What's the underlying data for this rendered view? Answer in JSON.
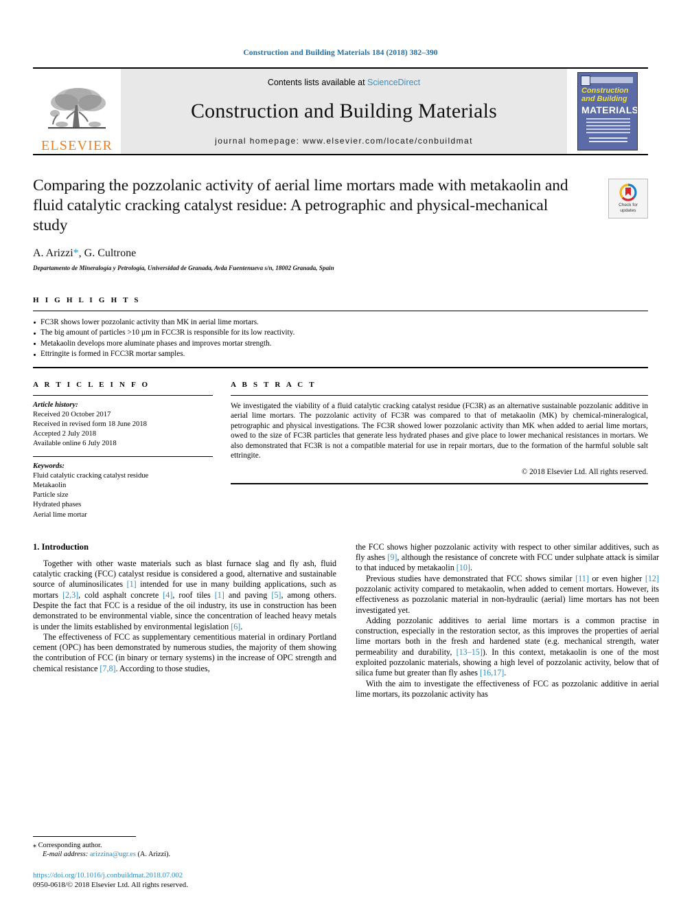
{
  "running_head": "Construction and Building Materials 184 (2018) 382–390",
  "masthead": {
    "publisher_name": "ELSEVIER",
    "contents_prefix": "Contents lists available at ",
    "contents_link": "ScienceDirect",
    "journal_title": "Construction and Building Materials",
    "homepage": "journal homepage: www.elsevier.com/locate/conbuildmat",
    "cover": {
      "line1": "Construction",
      "line2": "and Building",
      "line3": "MATERIALS"
    }
  },
  "article": {
    "title": "Comparing the pozzolanic activity of aerial lime mortars made with metakaolin and fluid catalytic cracking catalyst residue: A petrographic and physical-mechanical study",
    "authors_pre": "A. Arizzi",
    "authors_star": "*",
    "authors_post": ", G. Cultrone",
    "affiliation": "Departamento de Mineralogía y Petrología, Universidad de Granada, Avda Fuentenueva s/n, 18002 Granada, Spain",
    "crossmark_line1": "Check for",
    "crossmark_line2": "updates"
  },
  "highlights": {
    "heading": "H I G H L I G H T S",
    "items": [
      "FC3R shows lower pozzolanic activity than MK in aerial lime mortars.",
      "The big amount of particles >10 µm in FCC3R is responsible for its low reactivity.",
      "Metakaolin develops more aluminate phases and improves mortar strength.",
      "Ettringite is formed in FCC3R mortar samples."
    ]
  },
  "article_info": {
    "heading": "A R T I C L E   I N F O",
    "history_label": "Article history:",
    "history": [
      "Received 20 October 2017",
      "Received in revised form 18 June 2018",
      "Accepted 2 July 2018",
      "Available online 6 July 2018"
    ],
    "keywords_label": "Keywords:",
    "keywords": [
      "Fluid catalytic cracking catalyst residue",
      "Metakaolin",
      "Particle size",
      "Hydrated phases",
      "Aerial lime mortar"
    ]
  },
  "abstract": {
    "heading": "A B S T R A C T",
    "text": "We investigated the viability of a fluid catalytic cracking catalyst residue (FC3R) as an alternative sustainable pozzolanic additive in aerial lime mortars. The pozzolanic activity of FC3R was compared to that of metakaolin (MK) by chemical-mineralogical, petrographic and physical investigations. The FC3R showed lower pozzolanic activity than MK when added to aerial lime mortars, owed to the size of FC3R particles that generate less hydrated phases and give place to lower mechanical resistances in mortars. We also demonstrated that FC3R is not a compatible material for use in repair mortars, due to the formation of the harmful soluble salt ettringite.",
    "copyright": "© 2018 Elsevier Ltd. All rights reserved."
  },
  "body": {
    "section_heading": "1. Introduction",
    "left_paragraphs": [
      {
        "parts": [
          {
            "t": "Together with other waste materials such as blast furnace slag and fly ash, fluid catalytic cracking (FCC) catalyst residue is considered a good, alternative and sustainable source of aluminosilicates "
          },
          {
            "t": "[1]",
            "ref": true
          },
          {
            "t": " intended for use in many building applications, such as mortars "
          },
          {
            "t": "[2,3]",
            "ref": true
          },
          {
            "t": ", cold asphalt concrete "
          },
          {
            "t": "[4]",
            "ref": true
          },
          {
            "t": ", roof tiles "
          },
          {
            "t": "[1]",
            "ref": true
          },
          {
            "t": " and paving "
          },
          {
            "t": "[5]",
            "ref": true
          },
          {
            "t": ", among others. Despite the fact that FCC is a residue of the oil industry, its use in construction has been demonstrated to be environmental viable, since the concentration of leached heavy metals is under the limits established by environmental legislation "
          },
          {
            "t": "[6]",
            "ref": true
          },
          {
            "t": "."
          }
        ]
      },
      {
        "parts": [
          {
            "t": "The effectiveness of FCC as supplementary cementitious material in ordinary Portland cement (OPC) has been demonstrated by numerous studies, the majority of them showing the contribution of FCC (in binary or ternary systems) in the increase of OPC strength and chemical resistance "
          },
          {
            "t": "[7,8]",
            "ref": true
          },
          {
            "t": ". According to those studies,"
          }
        ]
      }
    ],
    "right_paragraphs": [
      {
        "indent": false,
        "parts": [
          {
            "t": "the FCC shows higher pozzolanic activity with respect to other similar additives, such as fly ashes "
          },
          {
            "t": "[9]",
            "ref": true
          },
          {
            "t": ", although the resistance of concrete with FCC under sulphate attack is similar to that induced by metakaolin "
          },
          {
            "t": "[10]",
            "ref": true
          },
          {
            "t": "."
          }
        ]
      },
      {
        "indent": true,
        "parts": [
          {
            "t": "Previous studies have demonstrated that FCC shows similar "
          },
          {
            "t": "[11]",
            "ref": true
          },
          {
            "t": " or even higher "
          },
          {
            "t": "[12]",
            "ref": true
          },
          {
            "t": " pozzolanic activity compared to metakaolin, when added to cement mortars. However, its effectiveness as pozzolanic material in non-hydraulic (aerial) lime mortars has not been investigated yet."
          }
        ]
      },
      {
        "indent": true,
        "parts": [
          {
            "t": "Adding pozzolanic additives to aerial lime mortars is a common practise in construction, especially in the restoration sector, as this improves the properties of aerial lime mortars both in the fresh and hardened state (e.g. mechanical strength, water permeability and durability, "
          },
          {
            "t": "[13–15]",
            "ref": true
          },
          {
            "t": "). In this context, metakaolin is one of the most exploited pozzolanic materials, showing a high level of pozzolanic activity, below that of silica fume but greater than fly ashes "
          },
          {
            "t": "[16,17]",
            "ref": true
          },
          {
            "t": "."
          }
        ]
      },
      {
        "indent": true,
        "parts": [
          {
            "t": "With the aim to investigate the effectiveness of FCC as pozzolanic additive in aerial lime mortars, its pozzolanic activity has"
          }
        ]
      }
    ]
  },
  "footnote": {
    "corresponding_star": "⁎",
    "corresponding": " Corresponding author.",
    "email_label": "E-mail address:",
    "email": "arizzina@ugr.es",
    "email_suffix": " (A. Arizzi).",
    "doi": "https://doi.org/10.1016/j.conbuildmat.2018.07.002",
    "issn_line": "0950-0618/© 2018 Elsevier Ltd. All rights reserved."
  },
  "colors": {
    "link_blue": "#2b8cc4",
    "header_blue": "#1f6fa8",
    "elsevier_orange": "#ef7d1a",
    "cover_blue": "#5a6ba8"
  }
}
